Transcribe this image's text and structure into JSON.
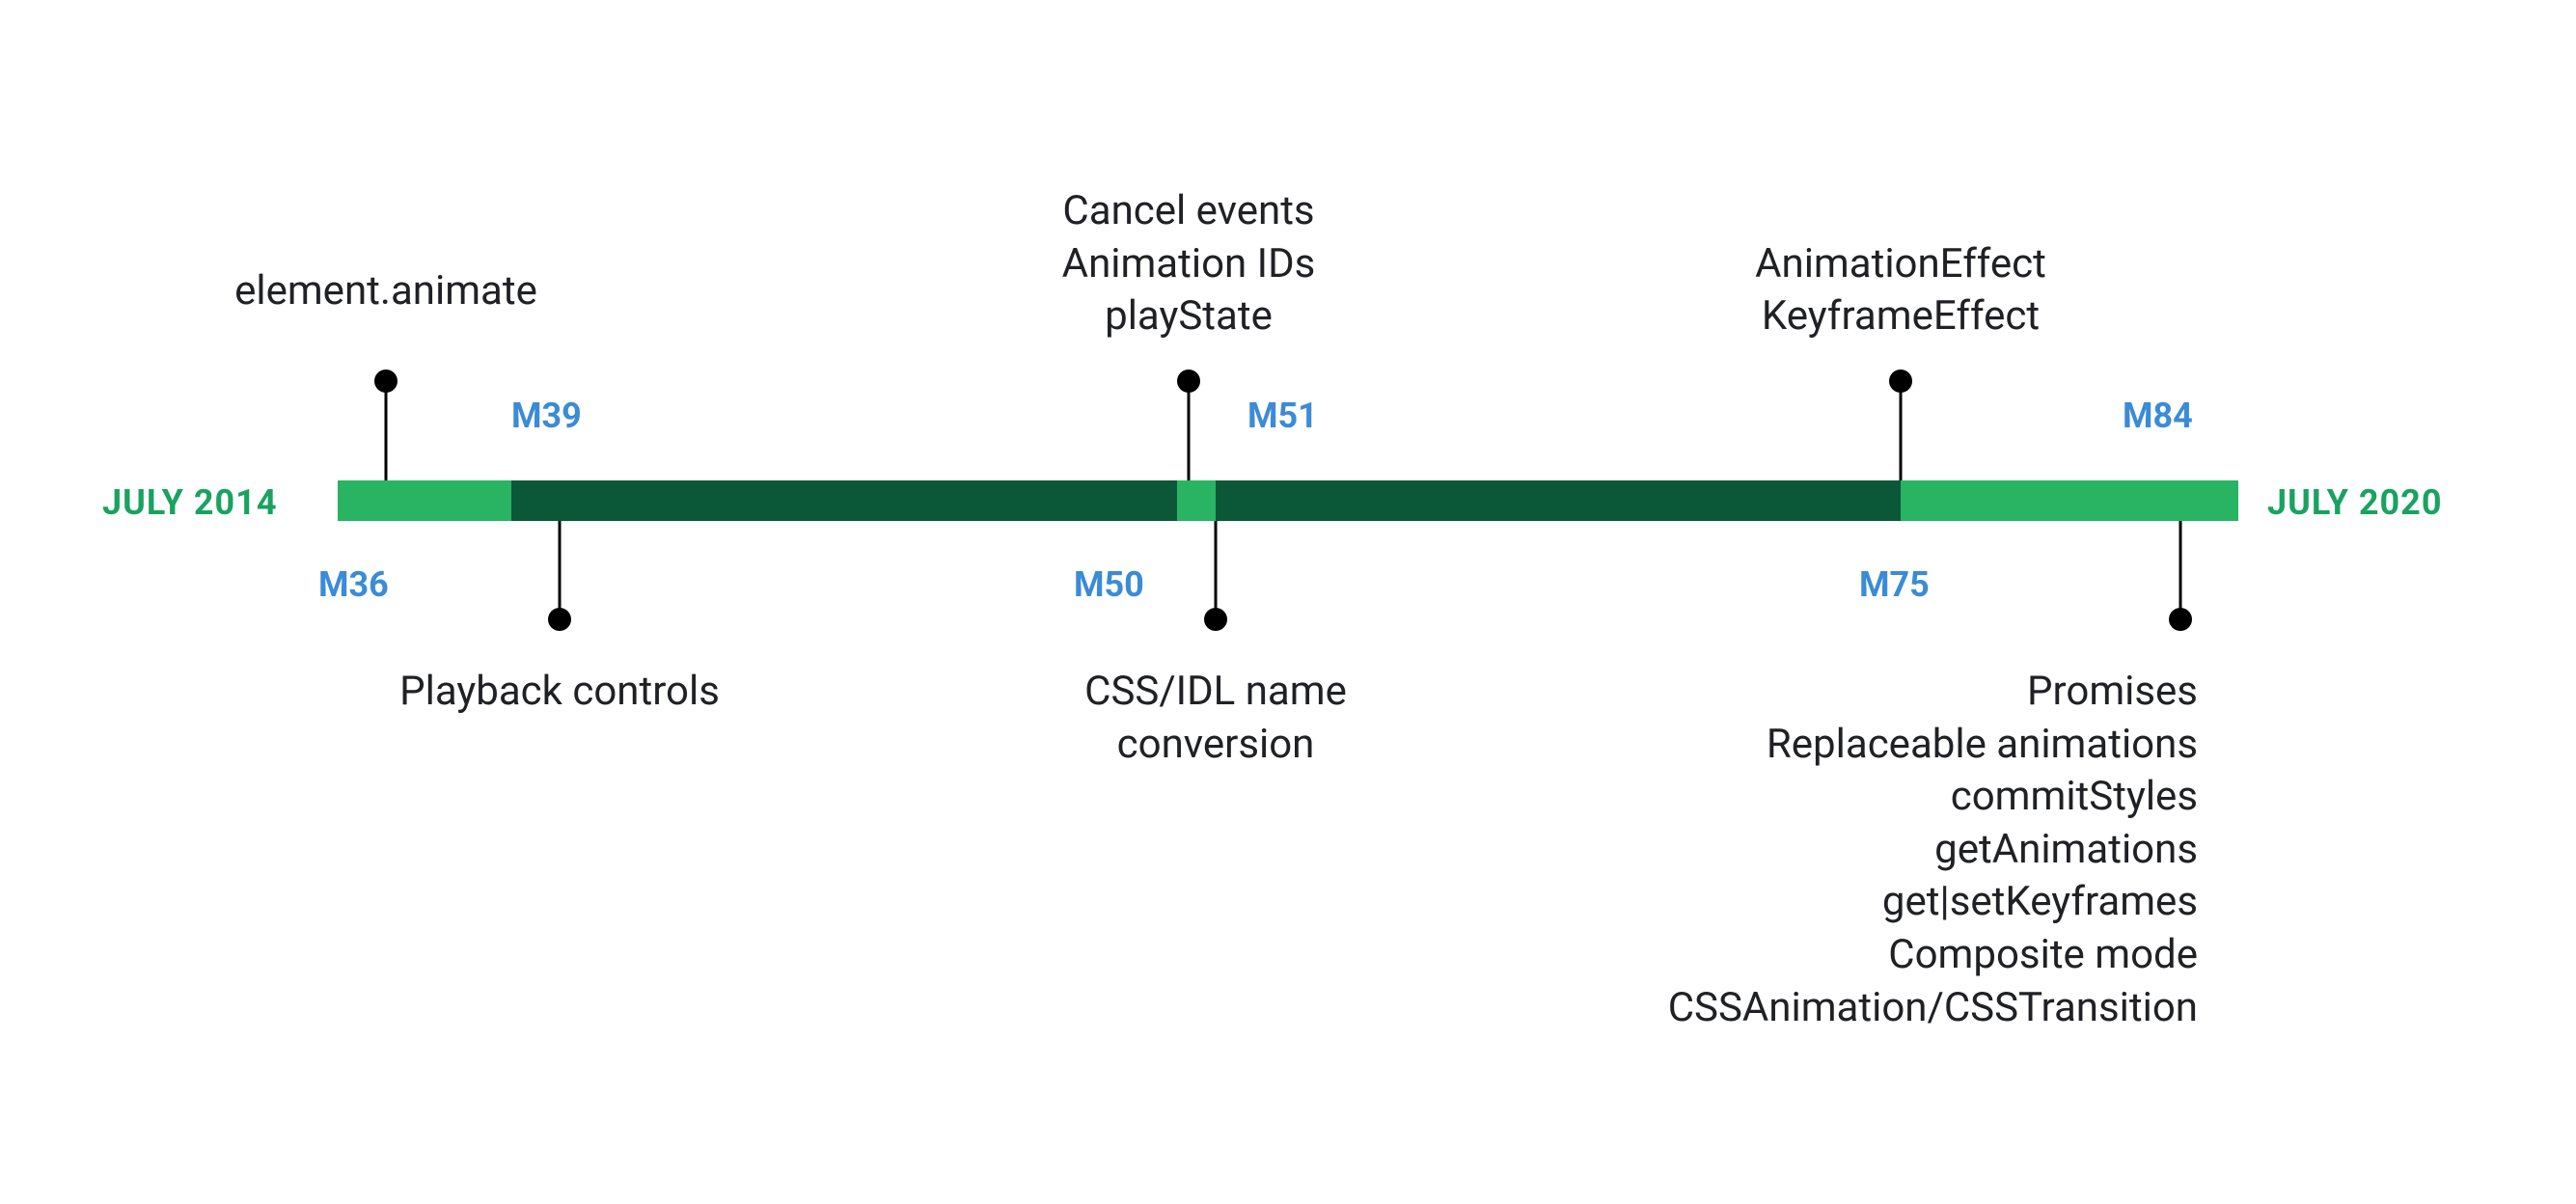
{
  "dates": {
    "start": "JULY 2014",
    "end": "JULY 2020"
  },
  "colors": {
    "bar_light": "#28b463",
    "bar_dark": "#0b5838",
    "date": "#1aa260",
    "version": "#3b8bd6",
    "text": "#202124"
  },
  "milestones": [
    {
      "version": "M36",
      "position": "above",
      "notes": [
        "element.animate"
      ]
    },
    {
      "version": "M39",
      "position": "below",
      "notes": [
        "Playback controls"
      ]
    },
    {
      "version": "M50",
      "position": "below",
      "notes": [
        "CSS/IDL name",
        "conversion"
      ]
    },
    {
      "version": "M51",
      "position": "above",
      "notes": [
        "Cancel events",
        "Animation IDs",
        "playState"
      ]
    },
    {
      "version": "M75",
      "position": "above",
      "notes": [
        "AnimationEffect",
        "KeyframeEffect"
      ]
    },
    {
      "version": "M84",
      "position": "below",
      "notes": [
        "Promises",
        "Replaceable animations",
        "commitStyles",
        "getAnimations",
        "get|setKeyframes",
        "Composite mode",
        "CSSAnimation/CSSTransition"
      ]
    }
  ],
  "chart_data": {
    "type": "timeline",
    "title": "",
    "range": {
      "start": "2014-07",
      "end": "2020-07"
    },
    "segments": [
      {
        "from": "2014-07",
        "to": "2014-10",
        "color": "light"
      },
      {
        "from": "2014-10",
        "to": "2016-04",
        "color": "dark"
      },
      {
        "from": "2016-04",
        "to": "2016-05",
        "color": "light"
      },
      {
        "from": "2016-05",
        "to": "2019-06",
        "color": "dark"
      },
      {
        "from": "2019-06",
        "to": "2020-07",
        "color": "light"
      }
    ],
    "events": [
      {
        "version": "M36",
        "date": "2014-07",
        "side": "above",
        "labels": [
          "element.animate"
        ]
      },
      {
        "version": "M39",
        "date": "2014-10",
        "side": "below",
        "labels": [
          "Playback controls"
        ]
      },
      {
        "version": "M50",
        "date": "2016-04",
        "side": "below",
        "labels": [
          "CSS/IDL name conversion"
        ]
      },
      {
        "version": "M51",
        "date": "2016-05",
        "side": "above",
        "labels": [
          "Cancel events",
          "Animation IDs",
          "playState"
        ]
      },
      {
        "version": "M75",
        "date": "2019-06",
        "side": "above",
        "labels": [
          "AnimationEffect",
          "KeyframeEffect"
        ]
      },
      {
        "version": "M84",
        "date": "2020-07",
        "side": "below",
        "labels": [
          "Promises",
          "Replaceable animations",
          "commitStyles",
          "getAnimations",
          "get|setKeyframes",
          "Composite mode",
          "CSSAnimation/CSSTransition"
        ]
      }
    ]
  }
}
